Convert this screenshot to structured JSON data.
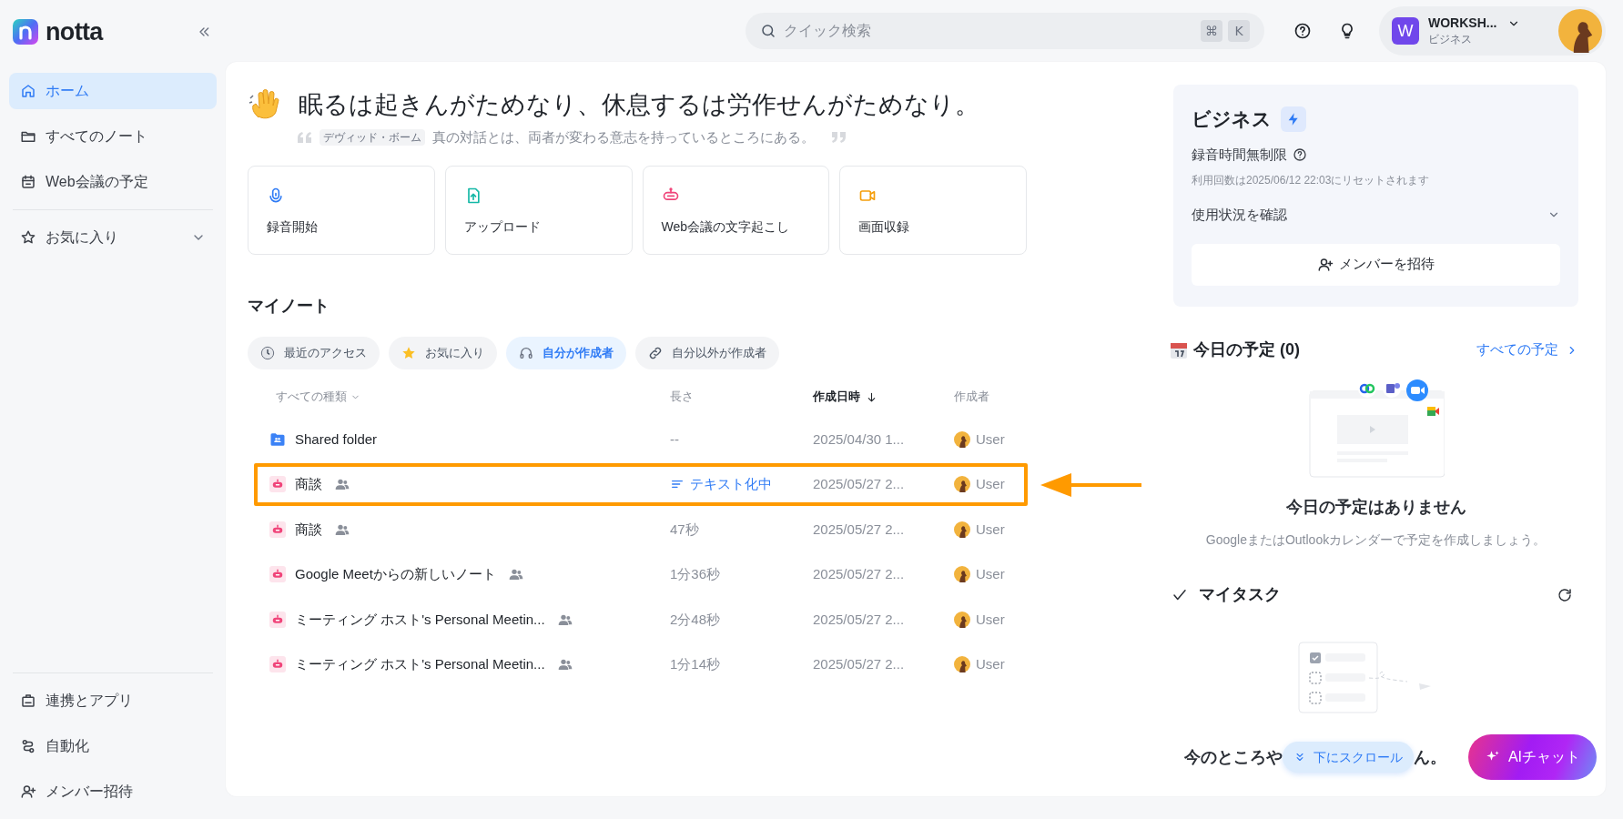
{
  "logo": {
    "text": "notta"
  },
  "sidebar": {
    "items": [
      {
        "label": "ホーム",
        "selected": true
      },
      {
        "label": "すべてのノート",
        "selected": false
      },
      {
        "label": "Web会議の予定",
        "selected": false
      }
    ],
    "favorites": {
      "label": "お気に入り"
    },
    "bottom_items": [
      {
        "label": "連携とアプリ"
      },
      {
        "label": "自動化"
      },
      {
        "label": "メンバー招待"
      }
    ]
  },
  "search": {
    "placeholder": "クイック検索",
    "keys": [
      "⌘",
      "K"
    ]
  },
  "workspace": {
    "initial": "W",
    "name": "WORKSH...",
    "plan": "ビジネス"
  },
  "greeting": {
    "title": "眠るは起きんがためなり、休息するは労作せんがためなり。",
    "author": "デヴィッド・ボーム",
    "quote": "真の対話とは、両者が変わる意志を持っているところにある。"
  },
  "actions": [
    {
      "label": "録音開始"
    },
    {
      "label": "アップロード"
    },
    {
      "label": "Web会議の文字起こし"
    },
    {
      "label": "画面収録"
    }
  ],
  "notes": {
    "title": "マイノート",
    "filters": [
      {
        "label": "最近のアクセス",
        "selected": false
      },
      {
        "label": "お気に入り",
        "selected": false
      },
      {
        "label": "自分が作成者",
        "selected": true
      },
      {
        "label": "自分以外が作成者",
        "selected": false
      }
    ],
    "columns": [
      {
        "label": "すべての種類",
        "kind": "filter"
      },
      {
        "label": "長さ",
        "kind": "plain"
      },
      {
        "label": "作成日時",
        "kind": "sort"
      },
      {
        "label": "作成者",
        "kind": "plain"
      }
    ],
    "rows": [
      {
        "kind": "folder",
        "name": "Shared folder",
        "shared": false,
        "length": "--",
        "processing": false,
        "date": "2025/04/30 1...",
        "creator": "User",
        "highlighted": false
      },
      {
        "kind": "note",
        "name": "商談",
        "shared": true,
        "length": "テキスト化中",
        "processing": true,
        "date": "2025/05/27 2...",
        "creator": "User",
        "highlighted": true
      },
      {
        "kind": "note",
        "name": "商談",
        "shared": true,
        "length": "47秒",
        "processing": false,
        "date": "2025/05/27 2...",
        "creator": "User",
        "highlighted": false
      },
      {
        "kind": "note",
        "name": "Google Meetからの新しいノート",
        "shared": true,
        "length": "1分36秒",
        "processing": false,
        "date": "2025/05/27 2...",
        "creator": "User",
        "highlighted": false
      },
      {
        "kind": "note",
        "name": "ミーティング ホスト's Personal Meetin...",
        "shared": true,
        "length": "2分48秒",
        "processing": false,
        "date": "2025/05/27 2...",
        "creator": "User",
        "highlighted": false
      },
      {
        "kind": "note",
        "name": "ミーティング ホスト's Personal Meetin...",
        "shared": true,
        "length": "1分14秒",
        "processing": false,
        "date": "2025/05/27 2...",
        "creator": "User",
        "highlighted": false
      }
    ]
  },
  "plan": {
    "title": "ビジネス",
    "limit": "録音時間無制限",
    "reset": "利用回数は2025/06/12 22:03にリセットされます",
    "usage": "使用状況を確認",
    "invite": "メンバーを招待"
  },
  "schedule": {
    "title": "今日の予定 (0)",
    "link": "すべての予定",
    "empty_title": "今日の予定はありません",
    "empty_text": "GoogleまたはOutlookカレンダーで予定を作成しましょう。"
  },
  "tasks": {
    "title": "マイタスク",
    "empty_start": "今のところや",
    "empty_end": "ん。"
  },
  "scroll_hint": {
    "label": "下にスクロール"
  },
  "ai_chat": {
    "label": "AIチャット"
  }
}
